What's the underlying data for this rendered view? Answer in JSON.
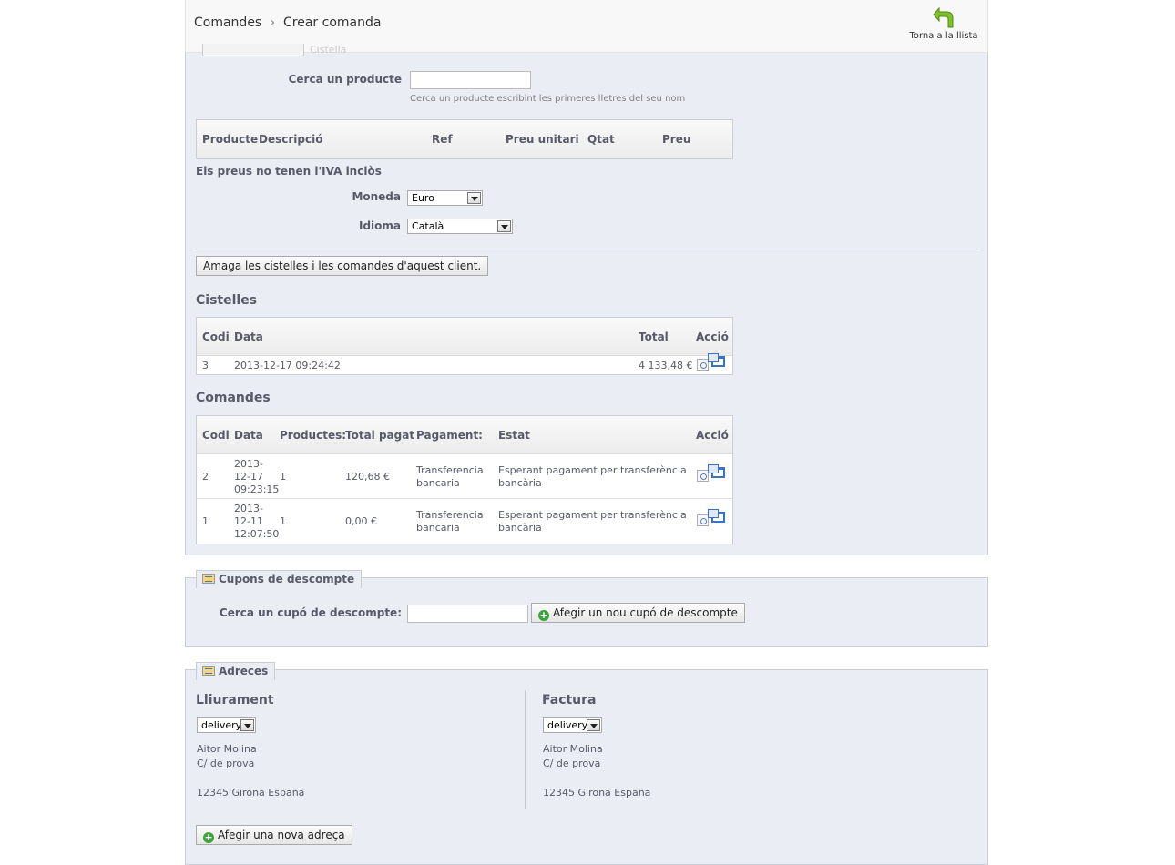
{
  "header": {
    "breadcrumb": [
      "Comandes",
      "Crear comanda"
    ],
    "back_label": "Torna a la llista",
    "ghost_tab_label": "Cistella"
  },
  "search_product": {
    "label": "Cerca un producte",
    "value": "",
    "hint": "Cerca un producte escribint les primeres lletres del seu nom"
  },
  "products_table": {
    "headers": [
      "Producte",
      "Descripció",
      "Ref",
      "Preu unitari",
      "Qtat",
      "Preu"
    ]
  },
  "vat_note": "Els preus no tenen l'IVA inclòs",
  "currency": {
    "label": "Moneda",
    "value": "Euro"
  },
  "language": {
    "label": "Idioma",
    "value": "Català"
  },
  "hide_carts_button": "Amaga les cistelles i les comandes d'aquest client.",
  "carts": {
    "title": "Cistelles",
    "headers": [
      "Codi",
      "Data",
      "Total",
      "Acció"
    ],
    "rows": [
      {
        "code": "3",
        "date": "2013-12-17 09:24:42",
        "total": "4 133,48 €"
      }
    ]
  },
  "orders": {
    "title": "Comandes",
    "headers": [
      "Codi",
      "Data",
      "Productes:",
      "Total pagat",
      "Pagament:",
      "Estat",
      "Acció"
    ],
    "rows": [
      {
        "code": "2",
        "date": [
          "2013-",
          "12-17",
          "09:23:15"
        ],
        "products": "1",
        "total": "120,68 €",
        "payment": [
          "Transferencia",
          "bancaria"
        ],
        "status": [
          "Esperant pagament per transferència",
          "bancària"
        ]
      },
      {
        "code": "1",
        "date": [
          "2013-",
          "12-11",
          "12:07:50"
        ],
        "products": "1",
        "total": "0,00 €",
        "payment": [
          "Transferencia",
          "bancaria"
        ],
        "status": [
          "Esperant pagament per transferència",
          "bancària"
        ]
      }
    ]
  },
  "coupons": {
    "legend": "Cupons de descompte",
    "label": "Cerca un cupó de descompte:",
    "value": "",
    "add_button": "Afegir un nou cupó de descompte"
  },
  "addresses": {
    "legend": "Adreces",
    "delivery": {
      "title": "Lliurament",
      "select": "delivery",
      "lines": [
        "Aitor Molina",
        "C/ de prova",
        "",
        "12345 Girona España"
      ]
    },
    "invoice": {
      "title": "Factura",
      "select": "delivery",
      "lines": [
        "Aitor Molina",
        "C/ de prova",
        "",
        "12345 Girona España"
      ]
    },
    "add_button": "Afegir una nova adreça"
  },
  "colors": {
    "panel_bg": "#ebedf4",
    "border": "#ccced7",
    "text": "#585a69",
    "accent_green": "#3da33d"
  }
}
